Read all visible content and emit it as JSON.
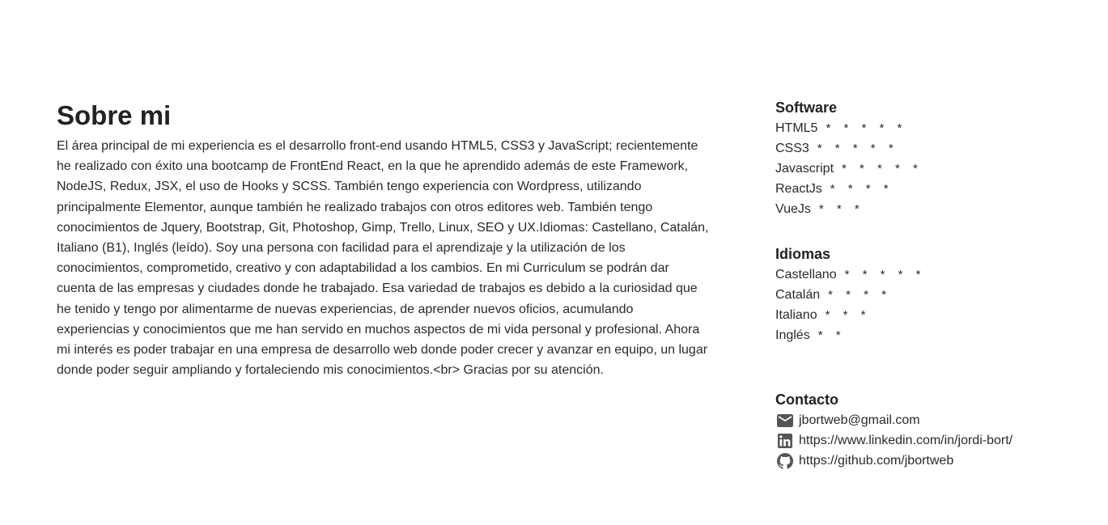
{
  "about": {
    "title": "Sobre mi",
    "text": "El área principal de mi experiencia es el desarrollo front-end usando HTML5, CSS3 y JavaScript; recientemente he realizado con éxito una bootcamp de FrontEnd React, en la que he aprendido además de este Framework, NodeJS, Redux, JSX, el uso de Hooks y SCSS. También tengo experiencia con Wordpress, utilizando principalmente Elementor, aunque también he realizado trabajos con otros editores web. También tengo conocimientos de Jquery, Bootstrap, Git, Photoshop, Gimp, Trello, Linux, SEO y UX.Idiomas: Castellano, Catalán, Italiano (B1), Inglés (leído). Soy una persona con facilidad para el aprendizaje y la utilización de los conocimientos, comprometido, creativo y con adaptabilidad a los cambios. En mi Curriculum se podrán dar cuenta de las empresas y ciudades donde he trabajado. Esa variedad de trabajos es debido a la curiosidad que he tenido y tengo por alimentarme de nuevas experiencias, de aprender nuevos oficios, acumulando experiencias y conocimientos que me han servido en muchos aspectos de mi vida personal y profesional. Ahora mi interés es poder trabajar en una empresa de desarrollo web donde poder crecer y avanzar en equipo, un lugar donde poder seguir ampliando y fortaleciendo mis conocimientos.<br> Gracias por su atención."
  },
  "software": {
    "title": "Software",
    "items": [
      {
        "name": "HTML5",
        "stars": "* * * * *"
      },
      {
        "name": "CSS3",
        "stars": "* * * * *"
      },
      {
        "name": "Javascript",
        "stars": "* * * * *"
      },
      {
        "name": "ReactJs",
        "stars": "* * * *"
      },
      {
        "name": "VueJs",
        "stars": "* * *"
      }
    ]
  },
  "idiomas": {
    "title": "Idiomas",
    "items": [
      {
        "name": "Castellano",
        "stars": "* * * * *"
      },
      {
        "name": "Catalán",
        "stars": "* * * *"
      },
      {
        "name": "Italiano",
        "stars": "* * *"
      },
      {
        "name": "Inglés",
        "stars": "* *"
      }
    ]
  },
  "contacto": {
    "title": "Contacto",
    "email": {
      "icon": "mail-icon",
      "text": "jbortweb@gmail.com"
    },
    "linkedin": {
      "icon": "linkedin-icon",
      "text": "https://www.linkedin.com/in/jordi-bort/"
    },
    "github": {
      "icon": "github-icon",
      "text": "https://github.com/jbortweb"
    }
  },
  "colors": {
    "text": "#222222",
    "icon": "#555555"
  }
}
